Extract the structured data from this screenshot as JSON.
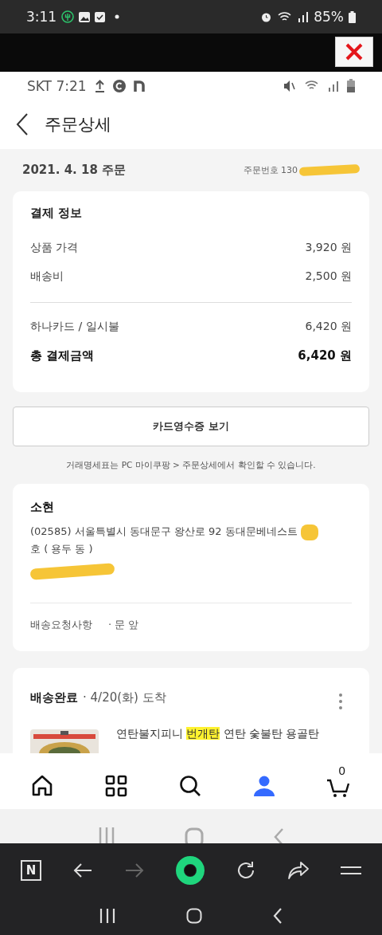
{
  "system_status": {
    "time": "3:11",
    "battery": "85%"
  },
  "app_status": {
    "carrier_time": "SKT 7:21"
  },
  "header": {
    "title": "주문상세"
  },
  "order": {
    "date": "2021. 4. 18 주문",
    "number": "주문번호 130"
  },
  "payment": {
    "title": "결제 정보",
    "items": [
      {
        "label": "상품 가격",
        "value": "3,920 원"
      },
      {
        "label": "배송비",
        "value": "2,500 원"
      }
    ],
    "totals": [
      {
        "emphasized": false,
        "label": "하나카드 / 일시불",
        "value": "6,420 원"
      },
      {
        "emphasized": true,
        "label": "총 결제금액",
        "value": "6,420 원"
      }
    ]
  },
  "receipt_button": "카드영수증 보기",
  "note": "거래명세표는 PC 마이쿠팡 > 주문상세에서 확인할 수 있습니다.",
  "shipping": {
    "name": "소현",
    "address": "(02585) 서울특별시 동대문구 왕산로 92 동대문베네스트",
    "address_unit": "호 ( 용두 동 )",
    "request_label": "배송요청사항",
    "request_value": "· 문 앞"
  },
  "delivery": {
    "status": "배송완료",
    "arrival": "· 4/20(화) 도착",
    "product_title": [
      {
        "text": "연탄불지피니 ",
        "highlighted": false
      },
      {
        "text": "번개탄",
        "highlighted": true
      },
      {
        "text": " 연탄 숯불탄 용골탄",
        "highlighted": false
      }
    ]
  },
  "bottom_nav": [
    {
      "kind": "home",
      "selected": false
    },
    {
      "kind": "categories",
      "selected": false
    },
    {
      "kind": "search",
      "selected": false
    },
    {
      "kind": "profile",
      "selected": true
    },
    {
      "kind": "cart",
      "selected": false,
      "badge": "0"
    }
  ],
  "browser_toolbar": {
    "tab_label": "N",
    "forward_disabled": true
  }
}
